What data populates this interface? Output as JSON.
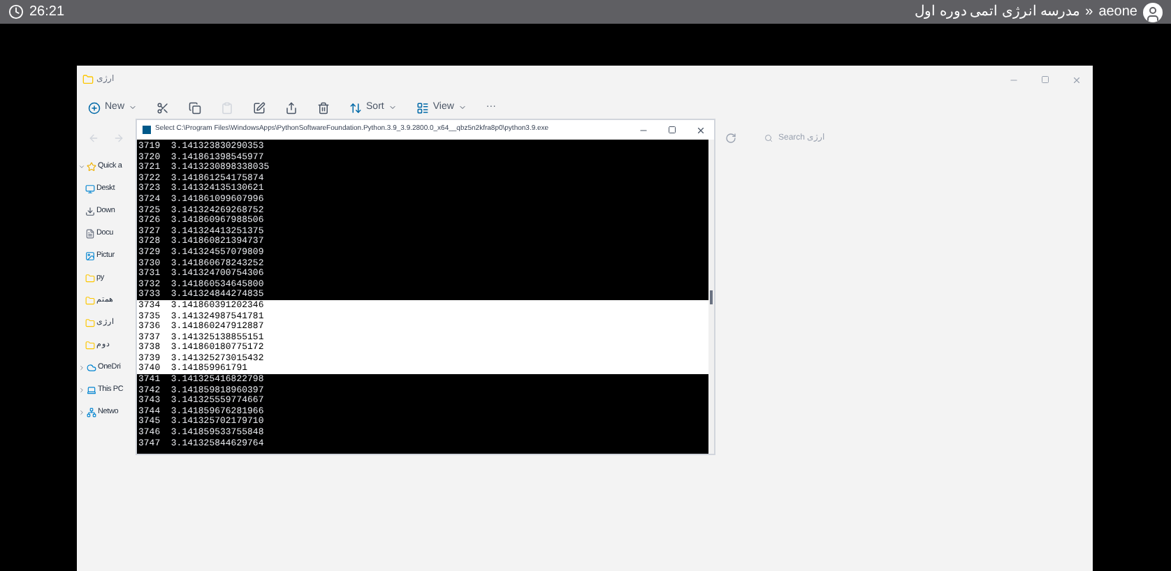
{
  "top_bar": {
    "time": "26:21",
    "breadcrumb": "مدرسه انرژی اتمی دوره اول",
    "separator": "»",
    "user": "aeone"
  },
  "explorer": {
    "title": "ارژی",
    "toolbar": [
      {
        "kind": "new",
        "label": "New"
      },
      {
        "kind": "cut"
      },
      {
        "kind": "copy"
      },
      {
        "kind": "paste"
      },
      {
        "kind": "rename"
      },
      {
        "kind": "share"
      },
      {
        "kind": "delete"
      },
      {
        "kind": "sort",
        "label": "Sort"
      },
      {
        "kind": "view",
        "label": "View"
      },
      {
        "kind": "more",
        "label": "···"
      }
    ],
    "search": {
      "placeholder": "Search ارژی"
    },
    "sidebar": [
      {
        "label": "Quick a",
        "kind": "star",
        "expanded": true,
        "children": [
          {
            "label": "Deskt",
            "kind": "desktop"
          },
          {
            "label": "Down",
            "kind": "download"
          },
          {
            "label": "Docu",
            "kind": "document"
          },
          {
            "label": "Pictur",
            "kind": "picture"
          },
          {
            "label": "py",
            "kind": "folder"
          },
          {
            "label": "همتم",
            "kind": "folder"
          },
          {
            "label": "ارژی",
            "kind": "folder"
          },
          {
            "label": "دوم",
            "kind": "folder"
          }
        ]
      },
      {
        "label": "OneDri",
        "kind": "cloud",
        "expanded": false
      },
      {
        "label": "This PC",
        "kind": "pc",
        "expanded": false
      },
      {
        "label": "Netwo",
        "kind": "network",
        "expanded": false
      }
    ]
  },
  "console": {
    "title": "Select C:\\Program Files\\WindowsApps\\PythonSoftwareFoundation.Python.3.9_3.9.2800.0_x64__qbz5n2kfra8p0\\python3.9.exe",
    "rows": [
      {
        "text": "3719  3.141323830290353",
        "selected": false
      },
      {
        "text": "3720  3.141861398545977",
        "selected": false
      },
      {
        "text": "3721  3.1413230898338035",
        "selected": false
      },
      {
        "text": "3722  3.141861254175874",
        "selected": false
      },
      {
        "text": "3723  3.141324135130621",
        "selected": false
      },
      {
        "text": "3724  3.141861099607996",
        "selected": false
      },
      {
        "text": "3725  3.141324269268752",
        "selected": false
      },
      {
        "text": "3726  3.141860967988506",
        "selected": false
      },
      {
        "text": "3727  3.141324413251375",
        "selected": false
      },
      {
        "text": "3728  3.141860821394737",
        "selected": false
      },
      {
        "text": "3729  3.141324557079809",
        "selected": false
      },
      {
        "text": "3730  3.141860678243252",
        "selected": false
      },
      {
        "text": "3731  3.141324700754306",
        "selected": false
      },
      {
        "text": "3732  3.141860534645800",
        "selected": false
      },
      {
        "text": "3733  3.141324844274835",
        "selected": false
      },
      {
        "text": "3734  3.141860391202346",
        "selected": true
      },
      {
        "text": "3735  3.141324987541781",
        "selected": true
      },
      {
        "text": "3736  3.141860247912887",
        "selected": true
      },
      {
        "text": "3737  3.141325138855151",
        "selected": true
      },
      {
        "text": "3738  3.141860180775172",
        "selected": true
      },
      {
        "text": "3739  3.141325273015432",
        "selected": true
      },
      {
        "text": "3740  3.141859961791",
        "selected": true
      },
      {
        "text": "3741  3.141325416822798",
        "selected": false
      },
      {
        "text": "3742  3.141859818960397",
        "selected": false
      },
      {
        "text": "3743  3.141325559774667",
        "selected": false
      },
      {
        "text": "3744  3.141859676281966",
        "selected": false
      },
      {
        "text": "3745  3.141325702179710",
        "selected": false
      },
      {
        "text": "3746  3.141859533755848",
        "selected": false
      },
      {
        "text": "3747  3.141325844629764",
        "selected": false
      }
    ]
  }
}
